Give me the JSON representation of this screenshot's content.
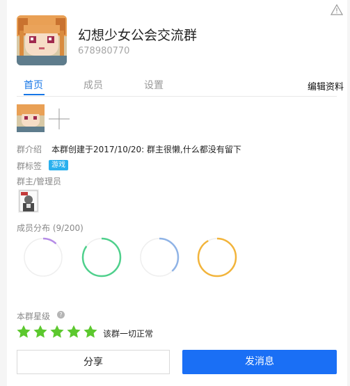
{
  "header": {
    "group_name": "幻想少女公会交流群",
    "group_id": "678980770"
  },
  "tabs": [
    {
      "label": "首页",
      "active": true
    },
    {
      "label": "成员",
      "active": false
    },
    {
      "label": "设置",
      "active": false
    }
  ],
  "edit_label": "编辑资料",
  "intro": {
    "label": "群介绍",
    "text": "本群创建于2017/10/20:  群主很懒,什么都没有留下"
  },
  "tags": {
    "label": "群标签",
    "items": [
      "游戏"
    ]
  },
  "admins": {
    "label": "群主/管理员"
  },
  "members": {
    "label": "成员分布",
    "count": "(9/200)",
    "distribution": [
      {
        "color": "#b58be6",
        "fraction": 0.12
      },
      {
        "color": "#4fd08c",
        "fraction": 0.85
      },
      {
        "color": "#8fb3e6",
        "fraction": 0.38
      },
      {
        "color": "#f2b43b",
        "fraction": 0.92
      }
    ]
  },
  "rating": {
    "label": "本群星级",
    "stars": 5,
    "max_stars": 5,
    "star_color": "#5cc82e",
    "status_text": "该群一切正常"
  },
  "buttons": {
    "share": "分享",
    "send": "发消息"
  },
  "colors": {
    "accent": "#1676e6",
    "send_button": "#1a6ff5",
    "tag": "#2ab0ee"
  }
}
